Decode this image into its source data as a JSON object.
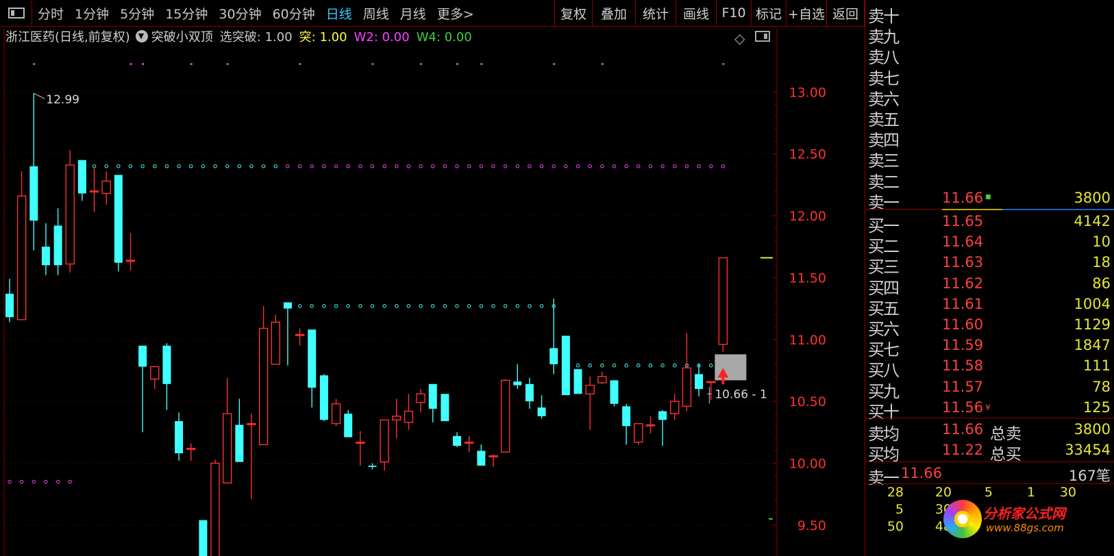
{
  "toolbar": {
    "periods": [
      "分时",
      "1分钟",
      "5分钟",
      "15分钟",
      "30分钟",
      "60分钟",
      "日线",
      "周线",
      "月线",
      "更多>"
    ],
    "active_period": "日线",
    "buttons": [
      "复权",
      "叠加",
      "统计",
      "画线",
      "F10",
      "标记",
      "+自选",
      "返回"
    ]
  },
  "info": {
    "stock_name": "浙江医药(日线,前复权)",
    "indicator_name": "突破小双顶",
    "fields": [
      {
        "label": "选突破:",
        "value": "1.00",
        "color": "#c8c8c8"
      },
      {
        "label": "突:",
        "value": "1.00",
        "color": "#ffff40"
      },
      {
        "label": "W2:",
        "value": "0.00",
        "color": "#ff40ff"
      },
      {
        "label": "W4:",
        "value": "0.00",
        "color": "#40d040"
      }
    ]
  },
  "chart_data": {
    "type": "candlestick",
    "ylim": [
      9.25,
      13.5
    ],
    "y_ticks": [
      "13.00",
      "12.50",
      "12.00",
      "11.50",
      "11.00",
      "10.50",
      "10.00",
      "9.50"
    ],
    "y_tick_values": [
      13.0,
      12.5,
      12.0,
      11.5,
      11.0,
      10.5,
      10.0,
      9.5
    ],
    "annotations": {
      "high_label": "12.99",
      "low_label": "10.66 - 1"
    },
    "up_color": "#ff3030",
    "down_color": "#40ffff",
    "candles": [
      {
        "o": 11.37,
        "h": 11.49,
        "l": 11.14,
        "c": 11.18
      },
      {
        "o": 11.16,
        "h": 12.36,
        "l": 11.16,
        "c": 12.16
      },
      {
        "o": 12.4,
        "h": 12.99,
        "l": 11.72,
        "c": 11.96
      },
      {
        "o": 11.75,
        "h": 11.94,
        "l": 11.52,
        "c": 11.6
      },
      {
        "o": 11.92,
        "h": 12.06,
        "l": 11.52,
        "c": 11.6
      },
      {
        "o": 11.61,
        "h": 12.53,
        "l": 11.54,
        "c": 12.41
      },
      {
        "o": 12.45,
        "h": 12.45,
        "l": 12.12,
        "c": 12.18
      },
      {
        "o": 12.2,
        "h": 12.39,
        "l": 12.03,
        "c": 12.2
      },
      {
        "o": 12.18,
        "h": 12.36,
        "l": 12.09,
        "c": 12.28
      },
      {
        "o": 12.33,
        "h": 12.33,
        "l": 11.55,
        "c": 11.62
      },
      {
        "o": 11.64,
        "h": 11.86,
        "l": 11.56,
        "c": 11.64
      },
      {
        "o": 10.95,
        "h": 10.95,
        "l": 10.25,
        "c": 10.78
      },
      {
        "o": 10.68,
        "h": 10.78,
        "l": 10.6,
        "c": 10.78
      },
      {
        "o": 10.95,
        "h": 10.97,
        "l": 10.43,
        "c": 10.64
      },
      {
        "o": 10.34,
        "h": 10.41,
        "l": 10.02,
        "c": 10.08
      },
      {
        "o": 10.12,
        "h": 10.16,
        "l": 10.02,
        "c": 10.12
      },
      {
        "o": 9.54,
        "h": 9.54,
        "l": 9.08,
        "c": 9.12
      },
      {
        "o": 9.08,
        "h": 10.03,
        "l": 9.08,
        "c": 10.0
      },
      {
        "o": 9.84,
        "h": 10.69,
        "l": 9.84,
        "c": 10.4
      },
      {
        "o": 10.31,
        "h": 10.52,
        "l": 10.02,
        "c": 10.01
      },
      {
        "o": 10.32,
        "h": 10.4,
        "l": 9.71,
        "c": 10.32
      },
      {
        "o": 10.15,
        "h": 11.27,
        "l": 10.15,
        "c": 11.09
      },
      {
        "o": 10.8,
        "h": 11.2,
        "l": 10.8,
        "c": 11.14
      },
      {
        "o": 11.3,
        "h": 11.3,
        "l": 10.79,
        "c": 11.25
      },
      {
        "o": 11.04,
        "h": 11.09,
        "l": 10.95,
        "c": 11.04
      },
      {
        "o": 11.08,
        "h": 11.08,
        "l": 10.45,
        "c": 10.61
      },
      {
        "o": 10.71,
        "h": 10.72,
        "l": 10.34,
        "c": 10.35
      },
      {
        "o": 10.32,
        "h": 10.52,
        "l": 10.3,
        "c": 10.48
      },
      {
        "o": 10.4,
        "h": 10.43,
        "l": 10.21,
        "c": 10.21
      },
      {
        "o": 10.17,
        "h": 10.26,
        "l": 9.98,
        "c": 10.17
      },
      {
        "o": 9.98,
        "h": 10.0,
        "l": 9.95,
        "c": 9.97
      },
      {
        "o": 10.01,
        "h": 10.35,
        "l": 9.94,
        "c": 10.35
      },
      {
        "o": 10.35,
        "h": 10.52,
        "l": 10.2,
        "c": 10.38
      },
      {
        "o": 10.33,
        "h": 10.56,
        "l": 10.27,
        "c": 10.42
      },
      {
        "o": 10.49,
        "h": 10.6,
        "l": 10.41,
        "c": 10.56
      },
      {
        "o": 10.64,
        "h": 10.64,
        "l": 10.33,
        "c": 10.44
      },
      {
        "o": 10.56,
        "h": 10.56,
        "l": 10.34,
        "c": 10.34
      },
      {
        "o": 10.22,
        "h": 10.25,
        "l": 10.13,
        "c": 10.14
      },
      {
        "o": 10.17,
        "h": 10.22,
        "l": 10.09,
        "c": 10.17
      },
      {
        "o": 10.1,
        "h": 10.15,
        "l": 9.98,
        "c": 9.98
      },
      {
        "o": 10.06,
        "h": 10.07,
        "l": 9.97,
        "c": 10.06
      },
      {
        "o": 10.09,
        "h": 10.68,
        "l": 10.09,
        "c": 10.67
      },
      {
        "o": 10.66,
        "h": 10.8,
        "l": 10.6,
        "c": 10.63
      },
      {
        "o": 10.64,
        "h": 10.69,
        "l": 10.44,
        "c": 10.5
      },
      {
        "o": 10.45,
        "h": 10.55,
        "l": 10.36,
        "c": 10.38
      },
      {
        "o": 10.93,
        "h": 11.33,
        "l": 10.72,
        "c": 10.8
      },
      {
        "o": 11.03,
        "h": 11.03,
        "l": 10.55,
        "c": 10.55
      },
      {
        "o": 10.76,
        "h": 10.76,
        "l": 10.56,
        "c": 10.56
      },
      {
        "o": 10.56,
        "h": 10.7,
        "l": 10.27,
        "c": 10.63
      },
      {
        "o": 10.65,
        "h": 10.74,
        "l": 10.64,
        "c": 10.7
      },
      {
        "o": 10.67,
        "h": 10.67,
        "l": 10.46,
        "c": 10.48
      },
      {
        "o": 10.46,
        "h": 10.48,
        "l": 10.15,
        "c": 10.3
      },
      {
        "o": 10.17,
        "h": 10.32,
        "l": 10.15,
        "c": 10.32
      },
      {
        "o": 10.31,
        "h": 10.38,
        "l": 10.24,
        "c": 10.31
      },
      {
        "o": 10.42,
        "h": 10.43,
        "l": 10.14,
        "c": 10.35
      },
      {
        "o": 10.4,
        "h": 10.56,
        "l": 10.35,
        "c": 10.5
      },
      {
        "o": 10.46,
        "h": 11.05,
        "l": 10.42,
        "c": 10.77
      },
      {
        "o": 10.72,
        "h": 10.8,
        "l": 10.54,
        "c": 10.6
      },
      {
        "o": 10.66,
        "h": 10.66,
        "l": 10.51,
        "c": 10.66
      },
      {
        "o": 10.96,
        "h": 11.66,
        "l": 10.9,
        "c": 11.66
      }
    ],
    "resistance_lines": [
      {
        "y": 12.4,
        "from": 6,
        "to": 22,
        "color": "#40d8d8"
      },
      {
        "y": 12.4,
        "from": 23,
        "to": 59,
        "color": "#d040d0"
      },
      {
        "y": 11.27,
        "from": 23,
        "to": 45,
        "color": "#40d8d8"
      },
      {
        "y": 10.79,
        "from": 46,
        "to": 59,
        "color": "#40d8d8"
      },
      {
        "y": 9.85,
        "from": 0,
        "to": 5,
        "color": "#d040d0"
      }
    ],
    "top_marks": [
      2,
      10,
      11,
      15,
      18,
      24,
      30,
      34,
      37,
      39,
      45,
      49,
      59
    ],
    "signal": {
      "index": 59,
      "zone_low": 10.67,
      "zone_high": 10.88
    }
  },
  "sidebar": {
    "asks": [
      {
        "label": "卖十",
        "price": "",
        "vol": ""
      },
      {
        "label": "卖九",
        "price": "",
        "vol": ""
      },
      {
        "label": "卖八",
        "price": "",
        "vol": ""
      },
      {
        "label": "卖七",
        "price": "",
        "vol": ""
      },
      {
        "label": "卖六",
        "price": "",
        "vol": ""
      },
      {
        "label": "卖五",
        "price": "",
        "vol": ""
      },
      {
        "label": "卖四",
        "price": "",
        "vol": ""
      },
      {
        "label": "卖三",
        "price": "",
        "vol": ""
      },
      {
        "label": "卖二",
        "price": "",
        "vol": ""
      },
      {
        "label": "卖一",
        "price": "11.66",
        "vol": "3800"
      }
    ],
    "bids": [
      {
        "label": "买一",
        "price": "11.65",
        "vol": "4142"
      },
      {
        "label": "买二",
        "price": "11.64",
        "vol": "10"
      },
      {
        "label": "买三",
        "price": "11.63",
        "vol": "18"
      },
      {
        "label": "买四",
        "price": "11.62",
        "vol": "86"
      },
      {
        "label": "买五",
        "price": "11.61",
        "vol": "1004"
      },
      {
        "label": "买六",
        "price": "11.60",
        "vol": "1129"
      },
      {
        "label": "买七",
        "price": "11.59",
        "vol": "1847"
      },
      {
        "label": "买八",
        "price": "11.58",
        "vol": "111"
      },
      {
        "label": "买九",
        "price": "11.57",
        "vol": "78"
      },
      {
        "label": "买十",
        "price": "11.56",
        "vol": "125"
      }
    ],
    "ask_avg": {
      "label": "卖均",
      "price": "11.66",
      "total_label": "总卖",
      "total": "3800"
    },
    "bid_avg": {
      "label": "买均",
      "price": "11.22",
      "total_label": "总买",
      "total": "33454"
    },
    "ask1_summary": {
      "label": "卖一",
      "price": "11.66",
      "count": "167笔"
    },
    "ticks": [
      [
        "28",
        "20",
        "5",
        "1",
        "30"
      ],
      [
        "5",
        "30",
        "",
        ""
      ],
      [
        "50",
        "48",
        "",
        "",
        ""
      ]
    ],
    "watermark": {
      "text": "分析家公式网",
      "url": "www.88gs.com"
    }
  }
}
